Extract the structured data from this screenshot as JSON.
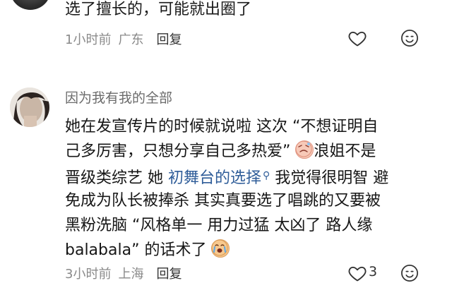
{
  "comments": [
    {
      "text": "选了擅长的，可能就出圈了",
      "time": "1小时前",
      "location": "广东",
      "reply_label": "回复"
    },
    {
      "username": "因为我有我的全部",
      "lines": [
        {
          "a": "她在发宣传片的时候就说啦 这次 “不想证明自"
        },
        {
          "a": "己多厉害，只想分享自己多热爱”",
          "b": "浪姐不是"
        },
        {
          "a": "晋级类综艺 她 ",
          "link": "初舞台的选择",
          "c": " 我觉得很明智 避"
        },
        {
          "a": "免成为队长被捧杀 其实真要选了唱跳的又要被"
        },
        {
          "a": "黑粉洗脑 “风格单一 用力过猛 太凶了 路人缘"
        },
        {
          "a": "balabala” 的话术了"
        }
      ],
      "time": "3小时前",
      "location": "上海",
      "reply_label": "回复",
      "like_count": "3"
    }
  ],
  "icons": {
    "like": "heart-outline-icon",
    "emoji_reply": "smiley-icon"
  }
}
